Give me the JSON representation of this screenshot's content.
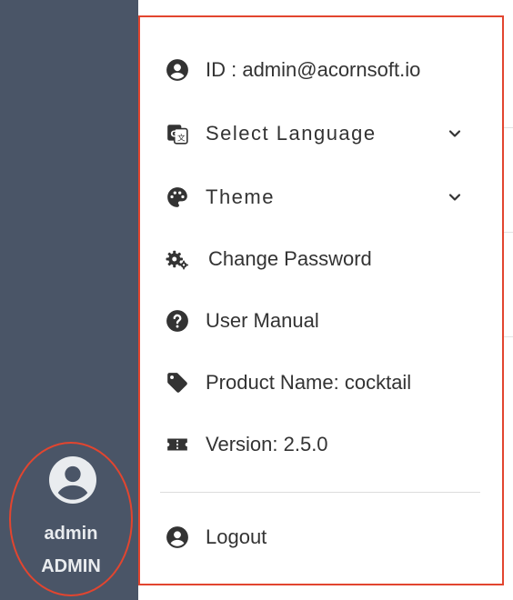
{
  "sidebar": {
    "user": {
      "name": "admin",
      "role": "ADMIN"
    }
  },
  "dropdown": {
    "items": [
      {
        "icon": "account-circle-icon",
        "label": "ID : admin@acornsoft.io"
      },
      {
        "icon": "translate-icon",
        "label": "Select Language",
        "has_chevron": true
      },
      {
        "icon": "palette-icon",
        "label": "Theme",
        "has_chevron": true
      },
      {
        "icon": "gears-icon",
        "label": "Change Password"
      },
      {
        "icon": "help-circle-icon",
        "label": "User Manual"
      },
      {
        "icon": "tag-icon",
        "label": "Product Name: cocktail"
      },
      {
        "icon": "ticket-icon",
        "label": "Version: 2.5.0"
      }
    ],
    "logout": {
      "icon": "account-circle-icon",
      "label": "Logout"
    }
  },
  "colors": {
    "sidebar_bg": "#4a5567",
    "highlight_border": "#e2452f",
    "text": "#333333",
    "icon": "#333333"
  }
}
